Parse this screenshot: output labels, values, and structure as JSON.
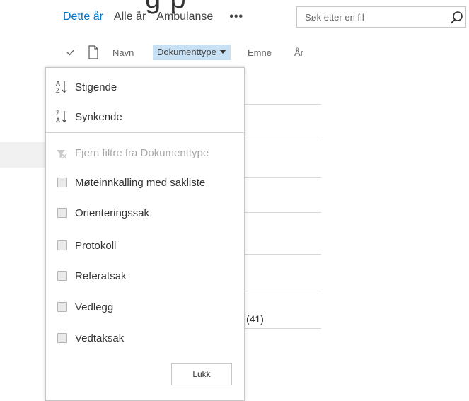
{
  "views": {
    "items": [
      "Dette år",
      "Alle år",
      "Ambulanse"
    ],
    "more_label": "•••"
  },
  "search": {
    "placeholder": "Søk etter en fil",
    "icon": "search-icon"
  },
  "columns": {
    "navn": "Navn",
    "dokumenttype": "Dokumenttype",
    "emne": "Emne",
    "ar": "År"
  },
  "list": {
    "count_label": "(41)"
  },
  "menu": {
    "sort_ascending": "Stigende",
    "sort_descending": "Synkende",
    "clear_filter": "Fjern filtre fra Dokumenttype",
    "filter_options": [
      "Møteinnkalling med sakliste",
      "Orienteringssak",
      "Protokoll",
      "Referatsak",
      "Vedlegg",
      "Vedtaksak"
    ],
    "close_label": "Lukk"
  },
  "colors": {
    "accent": "#0072c6",
    "header_highlight": "#c7e0f4"
  }
}
